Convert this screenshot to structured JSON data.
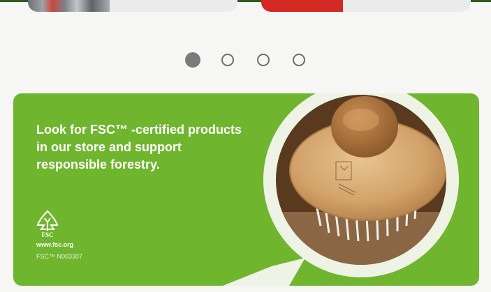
{
  "banner": {
    "headline": "Look for FSC™ -certified products in our store and support responsible forestry.",
    "fsc_logo_text": "FSC",
    "website": "www.fsc.org",
    "license_code": "FSC™ N003307"
  },
  "carousel": {
    "total_pages": 4,
    "active_page": 1
  },
  "colors": {
    "banner_green": "#6fb52e",
    "magnifier_ring": "#eef3e6",
    "dot_active": "#7b7b7b",
    "top_card_right_accent": "#d42a24"
  },
  "icons": [
    "fsc-tree-logo-icon"
  ]
}
